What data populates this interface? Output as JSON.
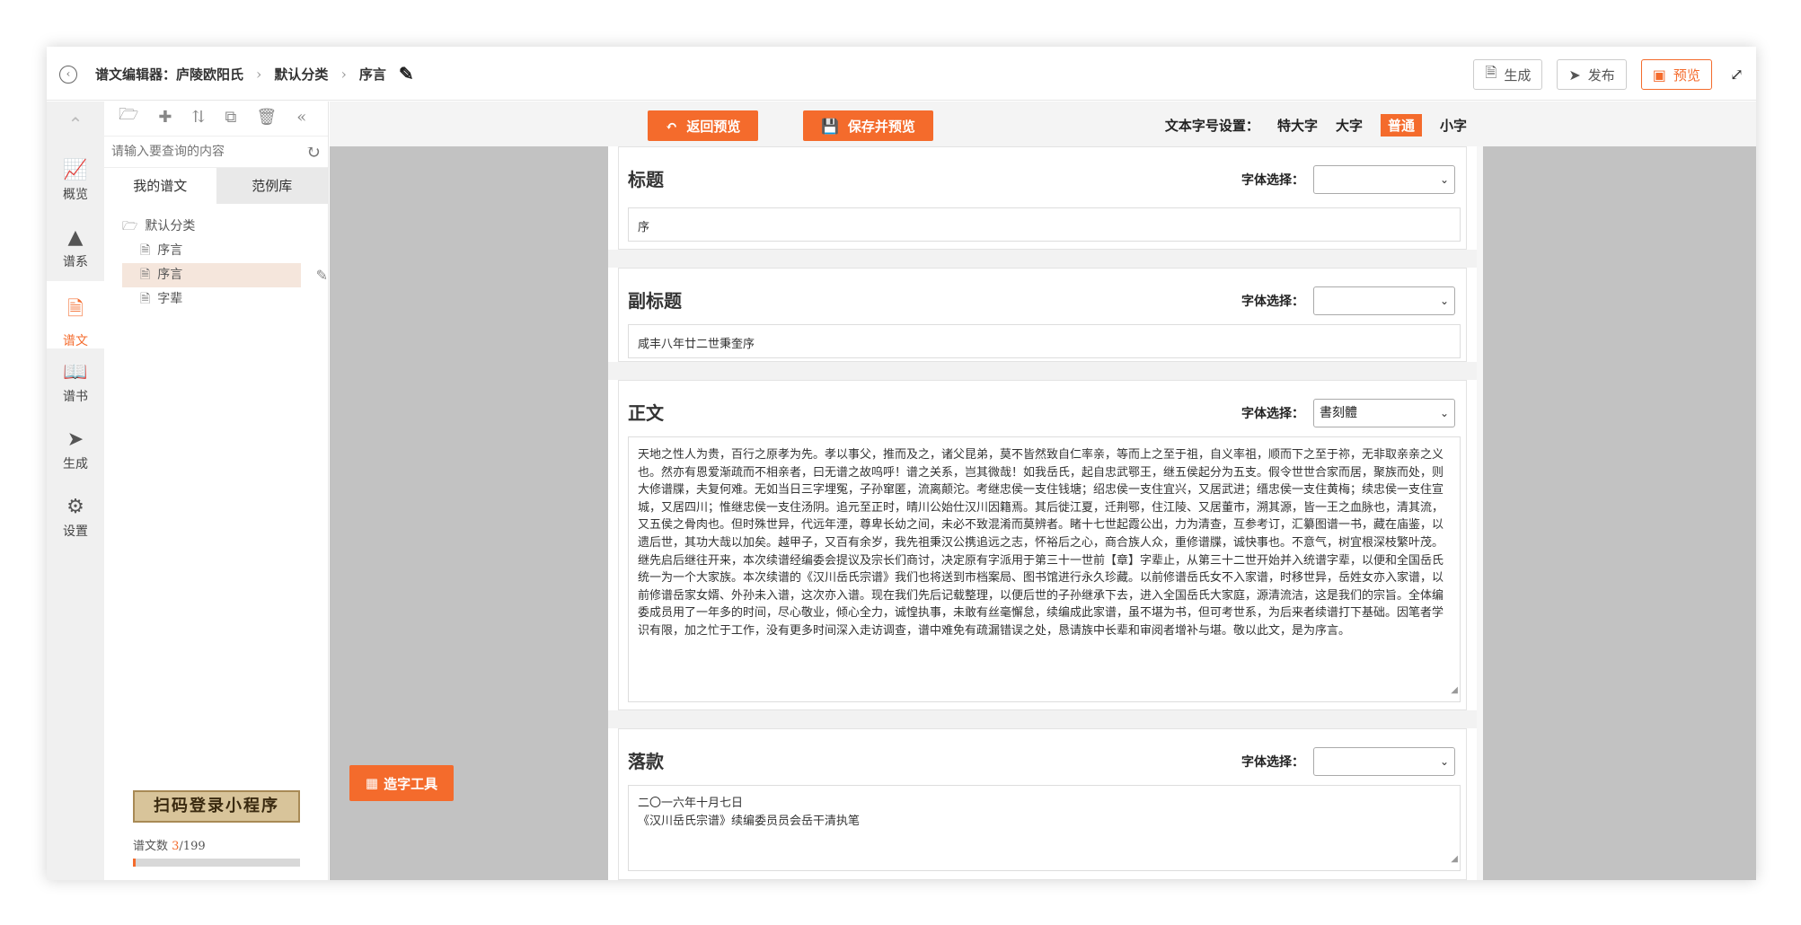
{
  "header": {
    "crumb_editor": "谱文编辑器：庐陵欧阳氏",
    "crumb_category": "默认分类",
    "crumb_page": "序言",
    "btn_generate": "生成",
    "btn_publish": "发布",
    "btn_preview": "预览"
  },
  "sidebar": {
    "items": [
      {
        "label": "概览",
        "icon": "chart-icon"
      },
      {
        "label": "谱系",
        "icon": "tree-icon"
      },
      {
        "label": "谱文",
        "icon": "document-icon"
      },
      {
        "label": "谱书",
        "icon": "book-icon"
      },
      {
        "label": "生成",
        "icon": "send-icon"
      },
      {
        "label": "设置",
        "icon": "gear-icon"
      }
    ],
    "active_index": 2
  },
  "tree": {
    "search_placeholder": "请输入要查询的内容",
    "tab_mine": "我的谱文",
    "tab_examples": "范例库",
    "folder": "默认分类",
    "nodes": [
      "序言",
      "序言",
      "字辈"
    ],
    "selected_index": 1,
    "qr_banner": "扫码登录小程序",
    "count_label": "谱文数 ",
    "count_current": "3",
    "count_total": "/199",
    "progress": 0.015
  },
  "toolbar": {
    "back_label": "返回预览",
    "save_label": "保存并预览",
    "font_size_label": "文本字号设置：",
    "sizes": [
      "特大字",
      "大字",
      "普通",
      "小字"
    ],
    "active_size": "普通"
  },
  "sections": {
    "title": {
      "heading": "标题",
      "font_label": "字体选择：",
      "font_value": "",
      "value": "序"
    },
    "subtitle": {
      "heading": "副标题",
      "font_label": "字体选择：",
      "font_value": "",
      "value": "咸丰八年廿二世秉奎序"
    },
    "body": {
      "heading": "正文",
      "font_label": "字体选择：",
      "font_value": "書刻體",
      "value": "天地之性人为贵，百行之原孝为先。孝以事父，推而及之，诸父昆弟，莫不皆然致自仁率亲，等而上之至于祖，自义率祖，顺而下之至于祢，无非取亲亲之义也。然亦有恩爱渐疏而不相亲者，曰无谱之故呜呼！谱之关系，岂其微哉！如我岳氏，起自忠武鄂王，继五侯起分为五支。假令世世合家而居，聚族而处，则大修谱牒，夫复何难。无如当日三字埋冤，子孙窜匿，流离颠沱。考继忠侯一支住钱塘；绍忠侯一支住宜兴，又居武进；缙忠侯一支住黄梅；续忠侯一支住宣城，又居四川；惟继忠侯一支住汤阴。追元至正时，晴川公始仕汉川因籍焉。其后徙江夏，迁荆鄂，住江陵、又居董市，溯其源，皆一王之血脉也，清其流，又五侯之骨肉也。但时殊世异，代远年湮，尊卑长幼之间，未必不致混淆而莫辨者。睹十七世起霞公出，力为清查，互参考订，汇纂图谱一书，藏在庙鉴，以遗后世，其功大哉以加矣。越甲子，又百有余岁，我先祖秉汉公携追远之志，怀裕后之心，商合族人众，重修谱牒，诚快事也。不意气，树宜根深枝繁叶茂。继先启后继往开来，本次续谱经编委会提议及宗长们商讨，决定原有字派用于第三十一世前【章】字辈止，从第三十二世开始并入统谱字辈，以便和全国岳氏统一为一个大家族。本次续谱的《汉川岳氏宗谱》我们也将送到市档案局、图书馆进行永久珍藏。以前修谱岳氏女不入家谱，时移世异，岳姓女亦入家谱，以前修谱岳家女婿、外孙未入谱，这次亦入谱。现在我们先后记载整理，以便后世的子孙继承下去，进入全国岳氏大家庭，源清流洁，这是我们的宗旨。全体编委成员用了一年多的时间，尽心敬业，倾心全力，诚惶执事，未敢有丝毫懈怠，续编成此家谱，虽不堪为书，但可考世系，为后来者续谱打下基础。因笔者学识有限，加之忙于工作，没有更多时间深入走访调查，谱中难免有疏漏错误之处，恳请族中长辈和审阅者增补与堪。敬以此文，是为序言。"
    },
    "signature": {
      "heading": "落款",
      "font_label": "字体选择：",
      "font_value": "",
      "value": "二〇一六年十月七日\n《汉川岳氏宗谱》续编委员员会岳干清执笔"
    }
  },
  "tool_button": "造字工具",
  "colors": {
    "accent": "#f46b2c",
    "selected_row": "#f5e6dc",
    "canvas": "#c2c2c2"
  }
}
